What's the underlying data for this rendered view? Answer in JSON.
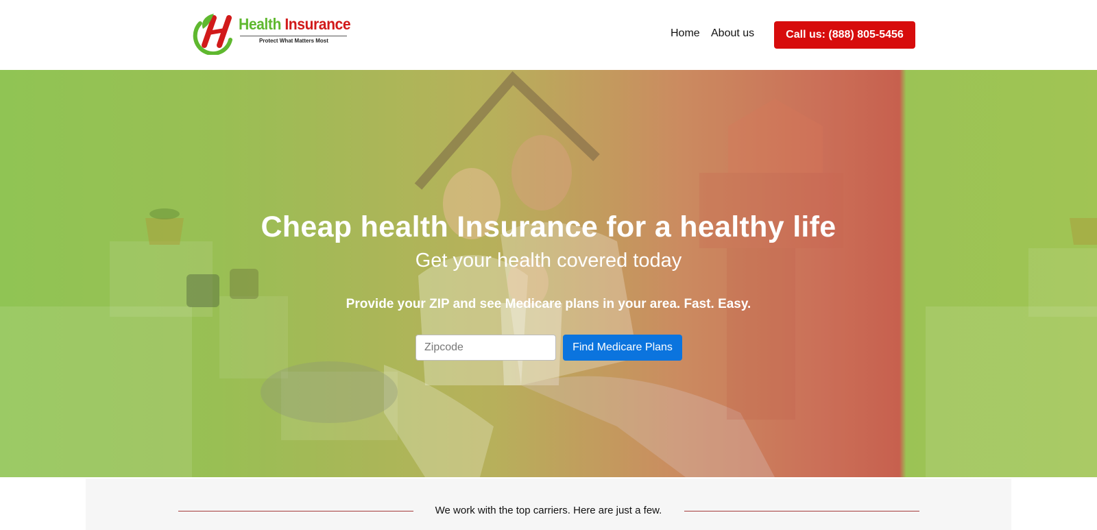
{
  "header": {
    "logo": {
      "title_word1": "Health",
      "title_word2": "Insurance",
      "tagline": "Protect What Matters Most",
      "icon": "health-insurance-h-logo"
    },
    "nav": {
      "home": "Home",
      "about": "About us"
    },
    "call_button": "Call us: (888) 805-5456"
  },
  "hero": {
    "title": "Cheap health Insurance for a healthy life",
    "subtitle": "Get your health covered today",
    "description": "Provide your ZIP and see Medicare plans in your area. Fast. Easy.",
    "zip_placeholder": "Zipcode",
    "zip_value": "",
    "find_button": "Find Medicare Plans",
    "image": "family-under-cardboard-roof-photo"
  },
  "carriers": {
    "text": "We work with the top carriers. Here are just a few."
  },
  "colors": {
    "brand_green": "#5fb82f",
    "brand_red": "#d11a1a",
    "call_button": "#d70c0c",
    "find_button": "#0b74de",
    "divider_line": "#a33a3a"
  }
}
